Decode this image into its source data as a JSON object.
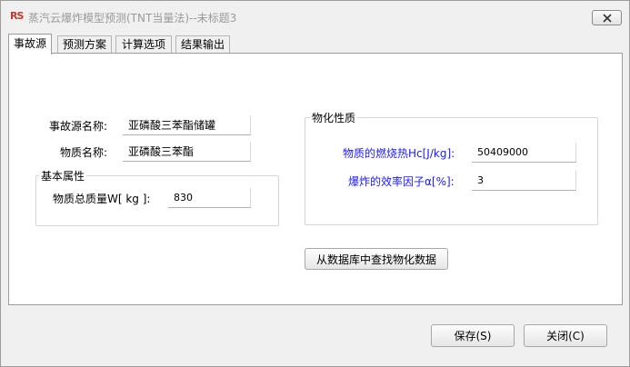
{
  "window": {
    "title": "蒸汽云爆炸模型预测(TNT当量法)--未标题3",
    "app_icon": "RS"
  },
  "tabs": [
    {
      "label": "事故源",
      "active": true
    },
    {
      "label": "预测方案",
      "active": false
    },
    {
      "label": "计算选项",
      "active": false
    },
    {
      "label": "结果输出",
      "active": false
    }
  ],
  "source": {
    "name_label": "事故源名称:",
    "name_value": "亚磷酸三苯酯储罐",
    "substance_label": "物质名称:",
    "substance_value": "亚磷酸三苯酯"
  },
  "basic": {
    "group_title": "基本属性",
    "mass_label": "物质总质量W[ kg ]:",
    "mass_value": "830"
  },
  "physchem": {
    "group_title": "物化性质",
    "heat_label": "物质的燃烧热Hc[J/kg]:",
    "heat_value": "50409000",
    "eff_label": "爆炸的效率因子α[%]:",
    "eff_value": "3"
  },
  "buttons": {
    "lookup": "从数据库中查找物化数据",
    "save": "保存(S)",
    "close": "关闭(C)"
  },
  "colors": {
    "accent_blue": "#1a1aff",
    "window_bg": "#f0f0f0"
  }
}
